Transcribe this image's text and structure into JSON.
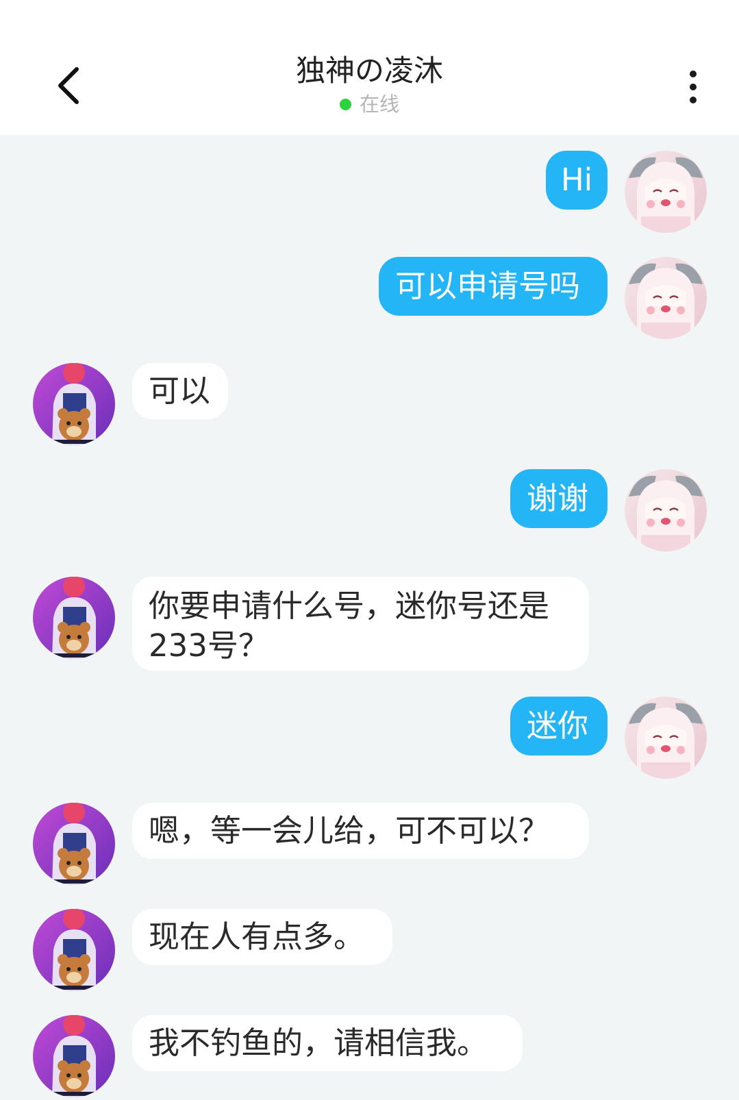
{
  "header": {
    "title": "独神の凌沐",
    "status_text": "在线",
    "status_color": "#2dd23d"
  },
  "icons": {
    "back": "chevron-left-icon",
    "more": "more-vertical-icon"
  },
  "colors": {
    "outgoing_bubble": "#23b5f6",
    "incoming_bubble": "#ffffff",
    "background": "#f1f5f5"
  },
  "messages": [
    {
      "side": "out",
      "text": "Hi"
    },
    {
      "side": "out",
      "text": "可以申请号吗"
    },
    {
      "side": "in",
      "text": "可以"
    },
    {
      "side": "out",
      "text": "谢谢"
    },
    {
      "side": "in",
      "text": "你要申请什么号，迷你号还是233号？"
    },
    {
      "side": "out",
      "text": "迷你"
    },
    {
      "side": "in",
      "text": "嗯，等一会儿给，可不可以？"
    },
    {
      "side": "in",
      "text": "现在人有点多。"
    },
    {
      "side": "in",
      "text": "我不钓鱼的，请相信我。"
    }
  ]
}
